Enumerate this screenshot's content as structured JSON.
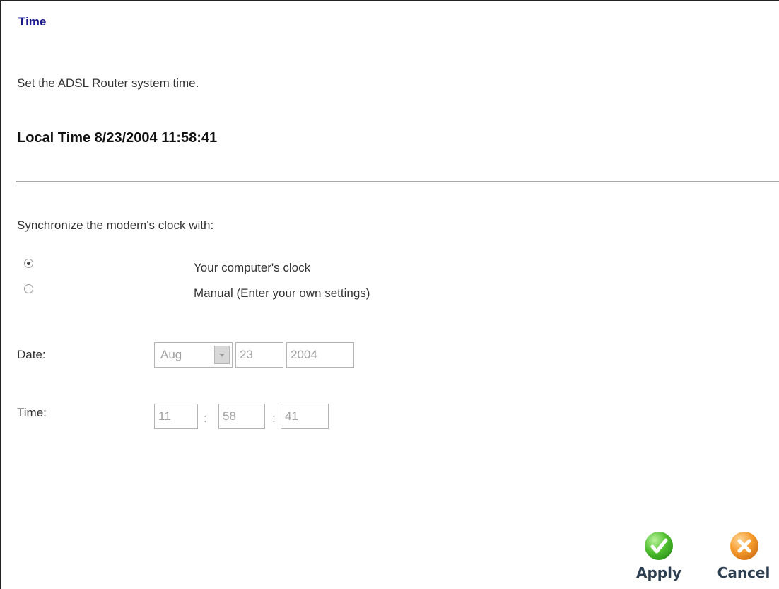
{
  "page": {
    "title": "Time",
    "description": "Set the ADSL Router system time.",
    "local_time_label": "Local Time 8/23/2004 11:58:41"
  },
  "sync": {
    "prompt": "Synchronize the modem's clock with:",
    "options": [
      {
        "label": "Your computer's clock",
        "selected": true
      },
      {
        "label": "Manual (Enter your own settings)",
        "selected": false
      }
    ]
  },
  "date": {
    "label": "Date:",
    "month": "Aug",
    "day": "23",
    "year": "2004"
  },
  "time": {
    "label": "Time:",
    "hour": "11",
    "minute": "58",
    "second": "41",
    "separator": ":"
  },
  "buttons": {
    "apply_label": "Apply",
    "cancel_label": "Cancel"
  },
  "colors": {
    "title": "#1a1a8c",
    "apply_icon": "#4fbf2e",
    "cancel_icon": "#f59a2b"
  },
  "icons": {
    "apply": "checkmark-icon",
    "cancel": "x-icon"
  }
}
